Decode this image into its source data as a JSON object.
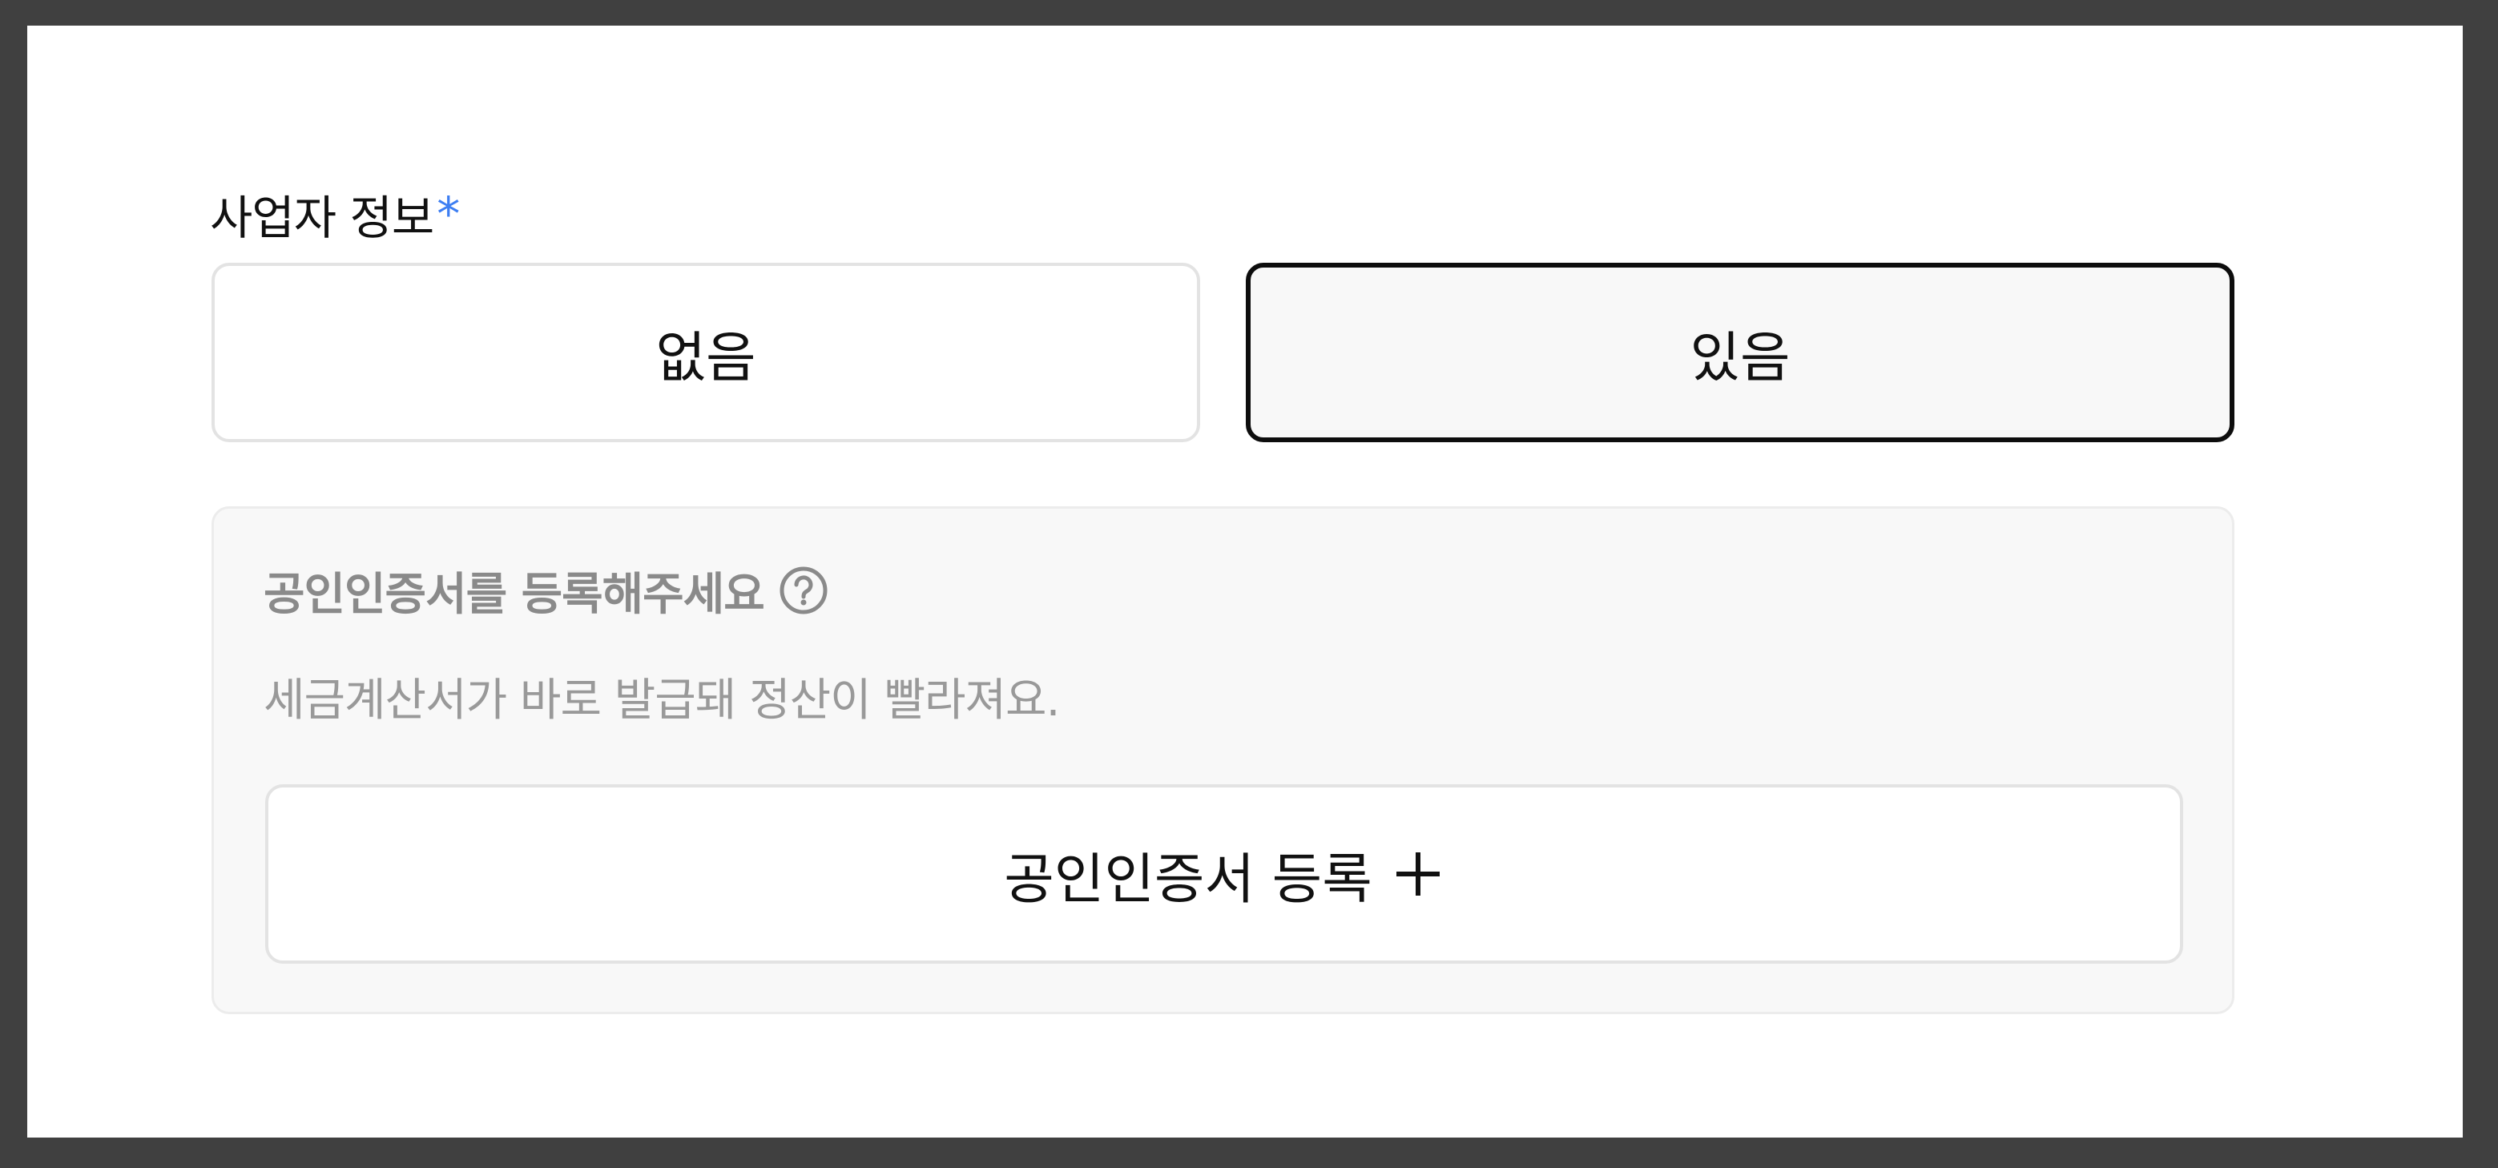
{
  "business_info": {
    "label": "사업자 정보",
    "required_mark": "*",
    "options": [
      {
        "label": "없음",
        "selected": false
      },
      {
        "label": "있음",
        "selected": true
      }
    ]
  },
  "certificate": {
    "heading": "공인인증서를 등록해주세요",
    "help_icon": "question-circle-icon",
    "description": "세금계산서가 바로 발급돼 정산이 빨라져요.",
    "register_button_label": "공인인증서 등록",
    "register_button_icon": "plus-icon"
  },
  "colors": {
    "required_accent": "#3d7ef2",
    "selected_border": "#0d0d0d",
    "muted_text": "#8a8a8a"
  }
}
